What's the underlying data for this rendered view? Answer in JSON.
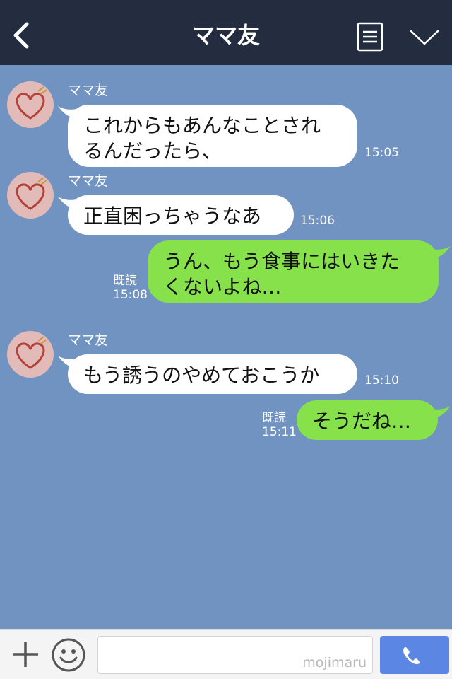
{
  "header": {
    "title": "ママ友"
  },
  "messages": [
    {
      "side": "in",
      "sender": "ママ友",
      "lines": [
        "これからもあんなことされ",
        "るんだったら、"
      ],
      "time": "15:05"
    },
    {
      "side": "in",
      "sender": "ママ友",
      "lines": [
        "正直困っちゃうなあ"
      ],
      "time": "15:06"
    },
    {
      "side": "out",
      "read": "既読",
      "lines": [
        "うん、もう食事にはいきた",
        "くないよね…"
      ],
      "time": "15:08"
    },
    {
      "side": "in",
      "sender": "ママ友",
      "lines": [
        "もう誘うのやめておこうか"
      ],
      "time": "15:10"
    },
    {
      "side": "out",
      "read": "既読",
      "lines": [
        "そうだね…"
      ],
      "time": "15:11"
    }
  ],
  "footer": {
    "watermark": "mojimaru"
  },
  "colors": {
    "header_bg": "#242c40",
    "chat_bg": "#7193c2",
    "bubble_in": "#ffffff",
    "bubble_out": "#86e14a",
    "send_button": "#5b86e3"
  },
  "icons": [
    "back-arrow-icon",
    "notes-icon",
    "chevron-down-icon",
    "plus-icon",
    "smiley-icon",
    "phone-icon"
  ]
}
